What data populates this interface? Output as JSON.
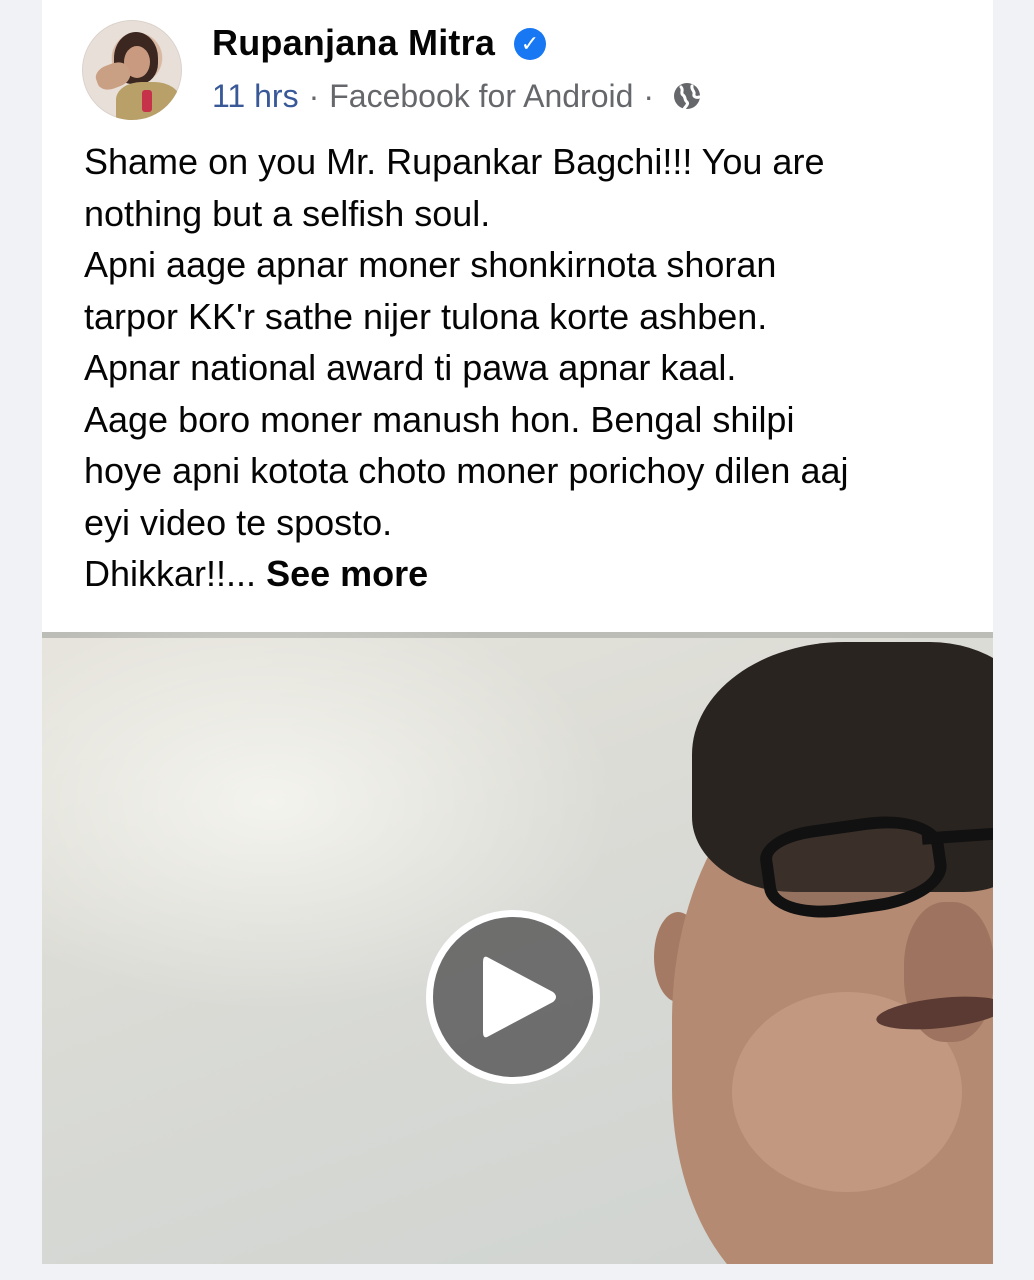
{
  "post": {
    "author": "Rupanjana Mitra",
    "time": "11 hrs",
    "separator": "·",
    "source": "Facebook for Android",
    "text_lines": [
      "Shame on you Mr. Rupankar Bagchi!!! You are",
      "nothing but a selfish soul.",
      "Apni aage apnar moner shonkirnota shoran",
      "tarpor KK'r  sathe nijer tulona korte ashben.",
      "Apnar national award ti pawa apnar kaal.",
      "Aage boro moner manush hon. Bengal shilpi",
      "hoye apni kotota choto moner porichoy dilen aaj",
      "eyi video te sposto."
    ],
    "last_line": "Dhikkar!!...",
    "see_more": "See more"
  },
  "icons": {
    "verified": "verified-badge-icon",
    "audience": "globe-icon",
    "play": "play-icon"
  },
  "colors": {
    "accent": "#1877f2",
    "meta_text": "#65676b",
    "time_link": "#385898",
    "text": "#050505",
    "background": "#f0f2f5"
  }
}
